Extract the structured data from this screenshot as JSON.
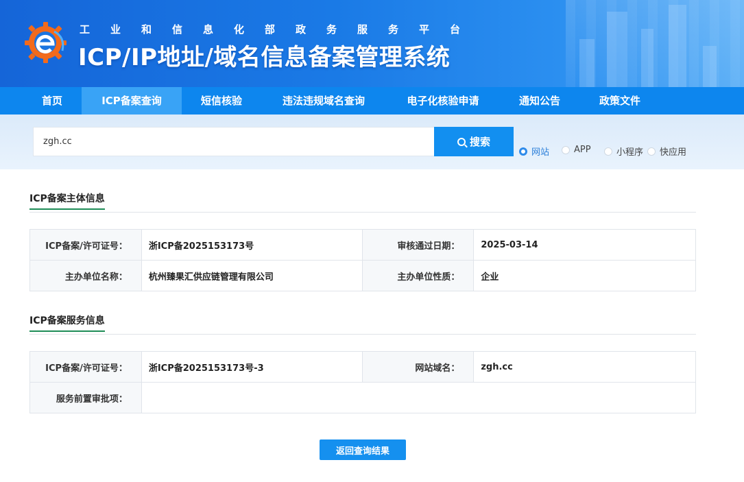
{
  "header": {
    "subtitle": "工业和信息化部政务服务平台",
    "title": "ICP/IP地址/域名信息备案管理系统"
  },
  "nav": {
    "items": [
      {
        "label": "首页",
        "active": false
      },
      {
        "label": "ICP备案查询",
        "active": true
      },
      {
        "label": "短信核验",
        "active": false
      },
      {
        "label": "违法违规域名查询",
        "active": false
      },
      {
        "label": "电子化核验申请",
        "active": false
      },
      {
        "label": "通知公告",
        "active": false
      },
      {
        "label": "政策文件",
        "active": false
      }
    ]
  },
  "search": {
    "value": "zgh.cc",
    "button_label": "搜索",
    "options": [
      {
        "label": "网站",
        "checked": true
      },
      {
        "label": "APP",
        "checked": false
      },
      {
        "label": "小程序",
        "checked": false
      },
      {
        "label": "快应用",
        "checked": false
      }
    ]
  },
  "subject_info": {
    "title": "ICP备案主体信息",
    "rows": [
      {
        "label1": "ICP备案/许可证号：",
        "value1": "浙ICP备2025153173号",
        "label2": "审核通过日期：",
        "value2": "2025-03-14"
      },
      {
        "label1": "主办单位名称：",
        "value1": "杭州臻果汇供应链管理有限公司",
        "label2": "主办单位性质：",
        "value2": "企业"
      }
    ]
  },
  "service_info": {
    "title": "ICP备案服务信息",
    "license_label": "ICP备案/许可证号：",
    "license_value": "浙ICP备2025153173号-3",
    "domain_label": "网站域名：",
    "domain_value": "zgh.cc",
    "preapproval_label": "服务前置审批项：",
    "preapproval_value": ""
  },
  "return_button": "返回查询结果",
  "colors": {
    "header_blue": "#1a7ae6",
    "nav_blue": "#0d86ee",
    "nav_active": "#39a3f6",
    "button_blue": "#128ff0",
    "section_underline": "#1d8c56"
  }
}
